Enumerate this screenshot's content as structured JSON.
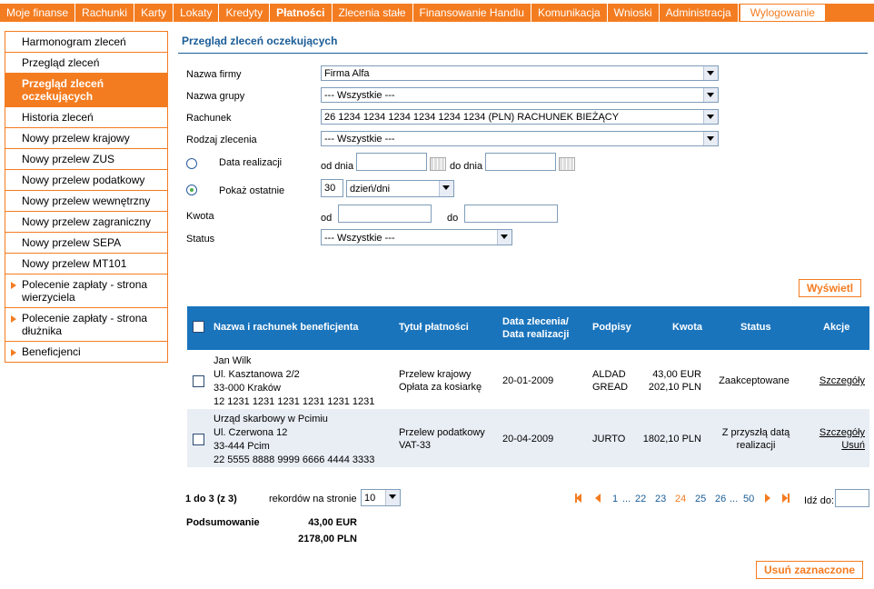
{
  "nav": {
    "items": [
      "Moje finanse",
      "Rachunki",
      "Karty",
      "Lokaty",
      "Kredyty",
      "Płatności",
      "Zlecenia stałe",
      "Finansowanie Handlu",
      "Komunikacja",
      "Wnioski",
      "Administracja"
    ],
    "logout": "Wylogowanie"
  },
  "sidebar": {
    "items": [
      {
        "label": "Harmonogram zleceń"
      },
      {
        "label": "Przegląd zleceń"
      },
      {
        "label": "Przegląd zleceń oczekujących"
      },
      {
        "label": "Historia zleceń"
      },
      {
        "label": "Nowy przelew krajowy"
      },
      {
        "label": "Nowy przelew ZUS"
      },
      {
        "label": "Nowy przelew podatkowy"
      },
      {
        "label": "Nowy przelew wewnętrzny"
      },
      {
        "label": "Nowy przelew zagraniczny"
      },
      {
        "label": "Nowy przelew SEPA"
      },
      {
        "label": "Nowy przelew MT101"
      },
      {
        "label": "Polecenie zapłaty - strona wierzyciela"
      },
      {
        "label": "Polecenie zapłaty - strona dłużnika"
      },
      {
        "label": "Beneficjenci"
      }
    ]
  },
  "page": {
    "title": "Przegląd zleceń oczekujących"
  },
  "form": {
    "company_label": "Nazwa firmy",
    "company_value": "Firma Alfa",
    "group_label": "Nazwa grupy",
    "group_value": "--- Wszystkie ---",
    "account_label": "Rachunek",
    "account_value": "26 1234 1234 1234 1234 1234 1234 (PLN) RACHUNEK BIEŻĄCY",
    "order_type_label": "Rodzaj zlecenia",
    "order_type_value": "--- Wszystkie ---",
    "date_label": "Data realizacji",
    "from_day_label": "od dnia",
    "to_day_label": "do dnia",
    "show_last_label": "Pokaż ostatnie",
    "show_last_value": "30",
    "show_last_unit": "dzień/dni",
    "amount_label": "Kwota",
    "amount_from_label": "od",
    "amount_to_label": "do",
    "status_label": "Status",
    "status_value": "--- Wszystkie ---",
    "show_button": "Wyświetl"
  },
  "table": {
    "headers": {
      "beneficiary": "Nazwa i rachunek beneficjenta",
      "title": "Tytuł płatności",
      "date_line1": "Data zlecenia/",
      "date_line2": "Data realizacji",
      "signatures": "Podpisy",
      "amount": "Kwota",
      "status": "Status",
      "actions": "Akcje"
    },
    "rows": [
      {
        "ben1": "Jan Wilk",
        "ben2": "Ul. Kasztanowa 2/2",
        "ben3": "33-000 Kraków",
        "ben4": "12 1231 1231 1231 1231 1231 1231",
        "title1": "Przelew krajowy",
        "title2": "Opłata za kosiarkę",
        "date": "20-01-2009",
        "sig1": "ALDAD",
        "sig2": "GREAD",
        "amt1": "43,00 EUR",
        "amt2": "202,10 PLN",
        "status1": "Zaakceptowane",
        "status2": "",
        "action1": "Szczegóły",
        "action2": ""
      },
      {
        "ben1": "Urząd skarbowy w Pcimiu",
        "ben2": "Ul. Czerwona 12",
        "ben3": "33-444 Pcim",
        "ben4": "22 5555 8888 9999 6666 4444 3333",
        "title1": "Przelew podatkowy",
        "title2": "VAT-33",
        "date": "20-04-2009",
        "sig1": "JURTO",
        "sig2": "",
        "amt1": "1802,10 PLN",
        "amt2": "",
        "status1": "Z przyszłą datą",
        "status2": "realizacji",
        "action1": "Szczegóły",
        "action2": "Usuń"
      }
    ]
  },
  "pagination": {
    "range": "1 do 3 (z 3)",
    "per_page_label": "rekordów na stronie",
    "per_page_value": "10",
    "pages": [
      "1",
      "...",
      "22",
      "23",
      "24",
      "25",
      "26",
      "...",
      "50"
    ],
    "current": "24",
    "goto_label": "Idź do:"
  },
  "summary": {
    "label": "Podsumowanie",
    "eur": "43,00 EUR",
    "pln": "2178,00 PLN"
  },
  "delete_button": "Usuń zaznaczone",
  "colors": {
    "accent": "#f47c20",
    "header_blue": "#1a74bc",
    "title_blue": "#1a5c96"
  }
}
